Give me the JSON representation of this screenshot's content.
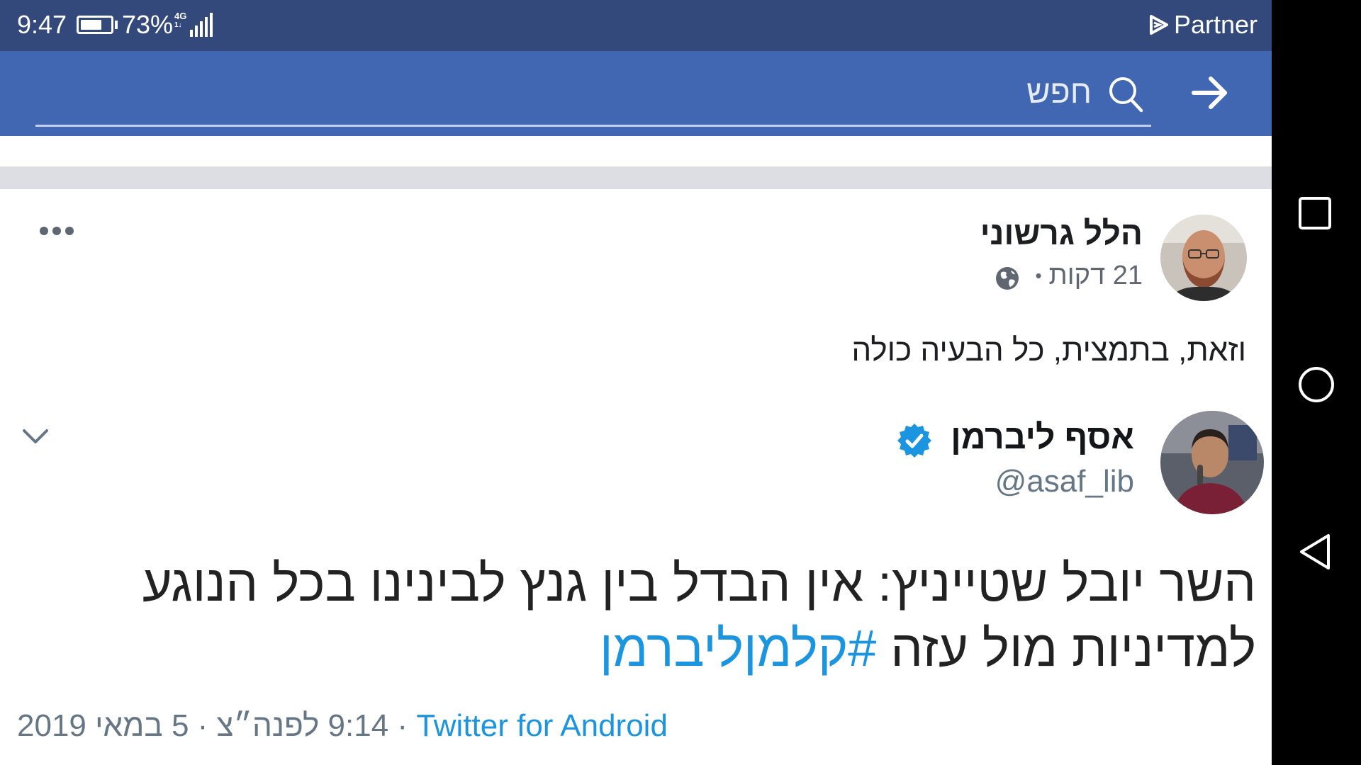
{
  "status_bar": {
    "time": "9:47",
    "battery_percent": "73%",
    "battery_level": 0.73,
    "network_type_top": "4G",
    "network_type_bottom": "1↓",
    "carrier": "Partner"
  },
  "app_bar": {
    "search_placeholder": "חפש",
    "back_icon": "arrow-right-icon",
    "search_icon": "search-icon"
  },
  "post": {
    "author": "הלל גרשוני",
    "time_ago": "21 דקות",
    "separator": "•",
    "privacy_icon": "globe-icon",
    "text": "וזאת, בתמצית, כל הבעיה כולה",
    "embedded_tweet": {
      "author": "אסף ליברמן",
      "verified": true,
      "handle": "@asaf_lib",
      "body": "השר יובל שטייניץ: אין הבדל בין גנץ לבינינו בכל הנוגע למדיניות מול עזה",
      "hashtag": "#קלמןליברמן",
      "source": "Twitter for Android",
      "timestamp": "9:14 לפנה״צ · 5 במאי 2019",
      "footer_separator": "·"
    }
  },
  "nav_bar": {
    "buttons": [
      "recents-square-icon",
      "home-circle-icon",
      "back-triangle-icon"
    ]
  },
  "colors": {
    "status_bar": "#34497b",
    "app_bar": "#4267b2",
    "divider": "#dcdee3",
    "link": "#1b95e0"
  }
}
